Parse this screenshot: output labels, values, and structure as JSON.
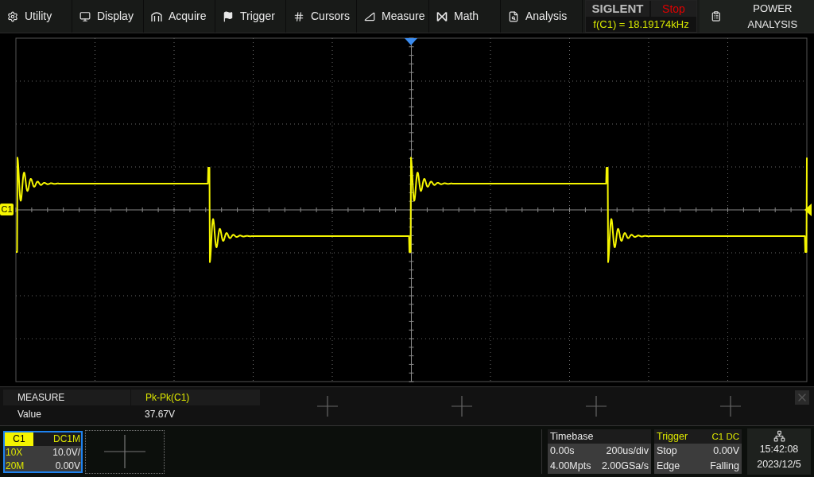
{
  "menu": [
    {
      "label": "Utility"
    },
    {
      "label": "Display"
    },
    {
      "label": "Acquire"
    },
    {
      "label": "Trigger"
    },
    {
      "label": "Cursors"
    },
    {
      "label": "Measure"
    },
    {
      "label": "Math"
    },
    {
      "label": "Analysis"
    }
  ],
  "status": {
    "brand": "SIGLENT",
    "run_state": "Stop",
    "frequency": "f(C1) = 18.19174kHz"
  },
  "power_button": {
    "label": "POWER ANALYSIS"
  },
  "screen": {
    "channel_marker": "C1"
  },
  "measure": {
    "title": "MEASURE",
    "value_label": "Value",
    "items": [
      {
        "name": "Pk-Pk(C1)",
        "value": "37.67V"
      }
    ]
  },
  "channels": [
    {
      "name": "C1",
      "selected": true,
      "coupling": "DC1M",
      "probe": "10X",
      "scale": "10.0V/",
      "bandwidth": "20M",
      "offset": "0.00V"
    }
  ],
  "timebase": {
    "title": "Timebase",
    "delay": "0.00s",
    "scale": "200us/div",
    "memory": "4.00Mpts",
    "sample_rate": "2.00GSa/s"
  },
  "trigger": {
    "title": "Trigger",
    "source": "C1 DC",
    "state": "Stop",
    "level": "0.00V",
    "type": "Edge",
    "slope": "Falling"
  },
  "clock": {
    "time": "15:42:08",
    "date": "2023/12/5"
  }
}
